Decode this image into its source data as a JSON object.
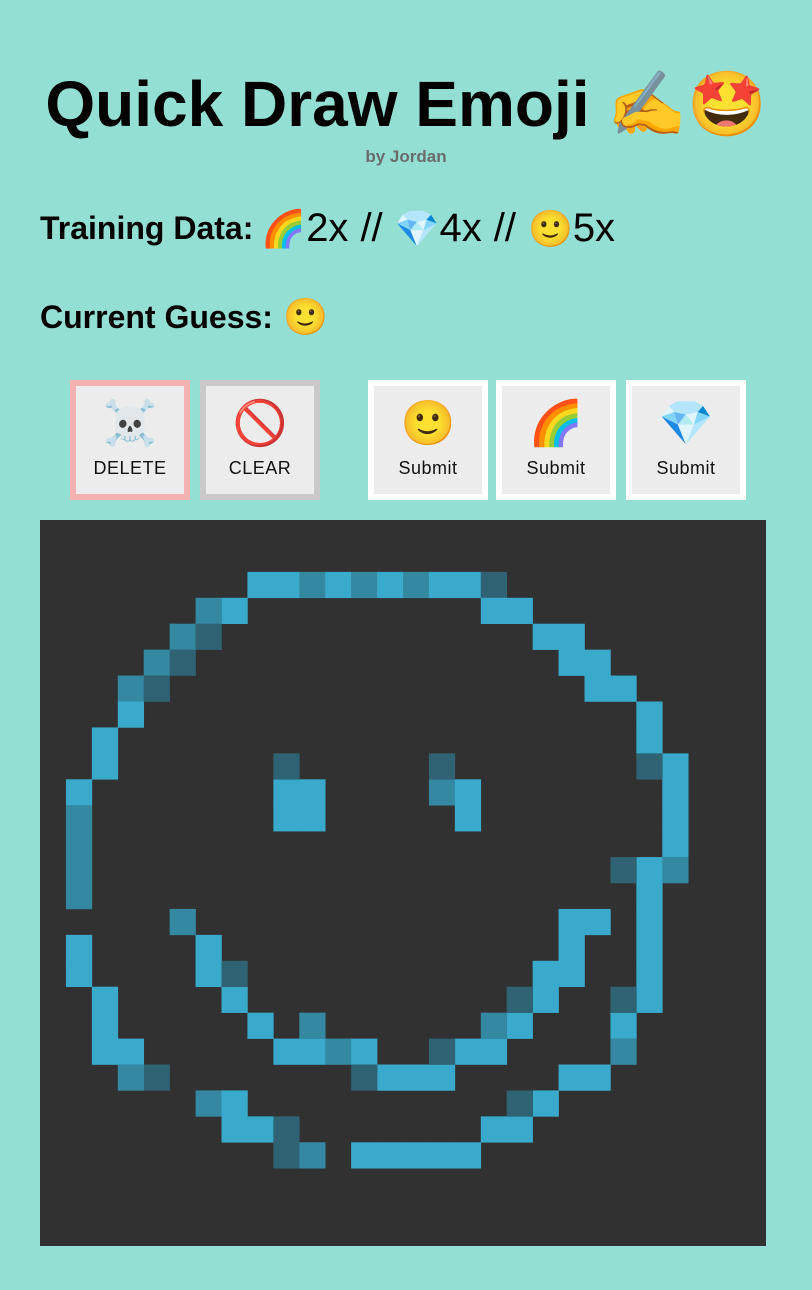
{
  "header": {
    "title": "Quick Draw Emoji ✍️🤩",
    "byline": "by Jordan"
  },
  "training": {
    "label": "Training Data:",
    "items": [
      {
        "emoji": "🌈",
        "count": "2x"
      },
      {
        "emoji": "💎",
        "count": "4x"
      },
      {
        "emoji": "🙂",
        "count": "5x"
      }
    ],
    "separator": "//"
  },
  "guess": {
    "label": "Current Guess:",
    "emoji": "🙂"
  },
  "buttons": {
    "delete": {
      "icon": "☠️",
      "label": "DELETE"
    },
    "clear": {
      "icon": "🚫",
      "label": "CLEAR"
    },
    "submit_smile": {
      "icon": "🙂",
      "label": "Submit"
    },
    "submit_rainbow": {
      "icon": "🌈",
      "label": "Submit"
    },
    "submit_gem": {
      "icon": "💎",
      "label": "Submit"
    }
  },
  "canvas": {
    "grid_cells": 28,
    "background": "#313131",
    "colors": {
      "bright": "#3aaacc",
      "mid": "#3488a2",
      "dim": "#2f6272"
    },
    "pixels": {
      "bright": [
        [
          8,
          2
        ],
        [
          9,
          2
        ],
        [
          10,
          2
        ],
        [
          11,
          2
        ],
        [
          12,
          2
        ],
        [
          13,
          2
        ],
        [
          14,
          2
        ],
        [
          15,
          2
        ],
        [
          16,
          2
        ],
        [
          17,
          2
        ],
        [
          7,
          3
        ],
        [
          17,
          3
        ],
        [
          18,
          3
        ],
        [
          19,
          4
        ],
        [
          20,
          4
        ],
        [
          20,
          5
        ],
        [
          21,
          5
        ],
        [
          3,
          6
        ],
        [
          21,
          6
        ],
        [
          22,
          6
        ],
        [
          3,
          7
        ],
        [
          23,
          7
        ],
        [
          2,
          8
        ],
        [
          23,
          8
        ],
        [
          2,
          9
        ],
        [
          24,
          9
        ],
        [
          1,
          10
        ],
        [
          9,
          10
        ],
        [
          10,
          10
        ],
        [
          15,
          10
        ],
        [
          16,
          10
        ],
        [
          24,
          10
        ],
        [
          9,
          11
        ],
        [
          10,
          11
        ],
        [
          16,
          11
        ],
        [
          24,
          11
        ],
        [
          1,
          12
        ],
        [
          24,
          12
        ],
        [
          23,
          13
        ],
        [
          24,
          13
        ],
        [
          23,
          14
        ],
        [
          20,
          15
        ],
        [
          21,
          15
        ],
        [
          23,
          15
        ],
        [
          1,
          16
        ],
        [
          6,
          16
        ],
        [
          20,
          16
        ],
        [
          23,
          16
        ],
        [
          1,
          17
        ],
        [
          6,
          17
        ],
        [
          19,
          17
        ],
        [
          20,
          17
        ],
        [
          23,
          17
        ],
        [
          2,
          18
        ],
        [
          7,
          18
        ],
        [
          19,
          18
        ],
        [
          23,
          18
        ],
        [
          2,
          19
        ],
        [
          8,
          19
        ],
        [
          18,
          19
        ],
        [
          22,
          19
        ],
        [
          2,
          20
        ],
        [
          3,
          20
        ],
        [
          9,
          20
        ],
        [
          10,
          20
        ],
        [
          11,
          20
        ],
        [
          12,
          20
        ],
        [
          16,
          20
        ],
        [
          17,
          20
        ],
        [
          22,
          20
        ],
        [
          4,
          21
        ],
        [
          13,
          21
        ],
        [
          14,
          21
        ],
        [
          15,
          21
        ],
        [
          20,
          21
        ],
        [
          21,
          21
        ],
        [
          6,
          22
        ],
        [
          7,
          22
        ],
        [
          19,
          22
        ],
        [
          7,
          23
        ],
        [
          8,
          23
        ],
        [
          17,
          23
        ],
        [
          18,
          23
        ],
        [
          12,
          24
        ],
        [
          13,
          24
        ],
        [
          14,
          24
        ],
        [
          15,
          24
        ],
        [
          16,
          24
        ]
      ],
      "mid": [
        [
          10,
          2
        ],
        [
          12,
          2
        ],
        [
          14,
          2
        ],
        [
          6,
          3
        ],
        [
          5,
          4
        ],
        [
          4,
          5
        ],
        [
          3,
          6
        ],
        [
          1,
          11
        ],
        [
          1,
          12
        ],
        [
          1,
          13
        ],
        [
          1,
          14
        ],
        [
          24,
          13
        ],
        [
          5,
          15
        ],
        [
          10,
          19
        ],
        [
          17,
          19
        ],
        [
          11,
          20
        ],
        [
          22,
          20
        ],
        [
          6,
          22
        ],
        [
          9,
          24
        ],
        [
          10,
          24
        ],
        [
          15,
          10
        ],
        [
          3,
          21
        ]
      ],
      "dim": [
        [
          17,
          2
        ],
        [
          6,
          4
        ],
        [
          5,
          5
        ],
        [
          4,
          6
        ],
        [
          9,
          9
        ],
        [
          15,
          9
        ],
        [
          23,
          9
        ],
        [
          22,
          13
        ],
        [
          7,
          17
        ],
        [
          18,
          18
        ],
        [
          22,
          18
        ],
        [
          15,
          20
        ],
        [
          4,
          21
        ],
        [
          12,
          21
        ],
        [
          18,
          22
        ],
        [
          9,
          23
        ],
        [
          9,
          24
        ]
      ]
    }
  }
}
